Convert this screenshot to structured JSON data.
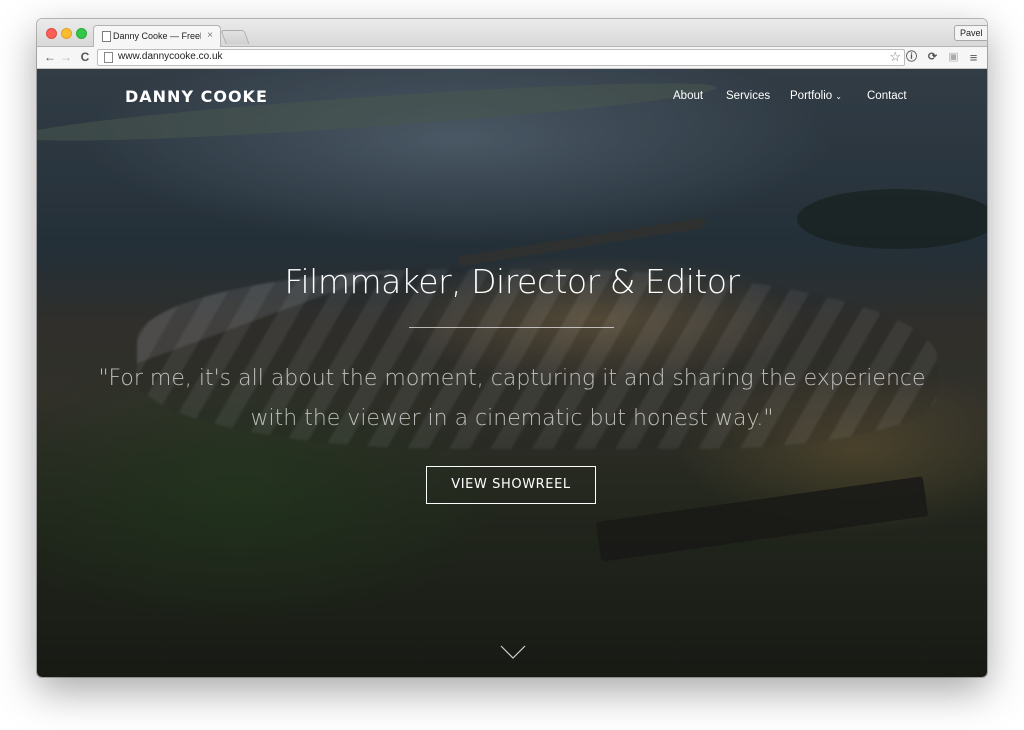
{
  "browser": {
    "tab_title": "Danny Cooke — Freelance",
    "tab_close_glyph": "×",
    "profile_name": "Pavel",
    "url": "www.dannycooke.co.uk",
    "icons": [
      "back-arrow-icon",
      "forward-arrow-icon",
      "reload-icon",
      "page-icon",
      "star-icon",
      "info-extension-icon",
      "sync-extension-icon",
      "camera-extension-icon",
      "menu-icon"
    ]
  },
  "site": {
    "brand": "DANNY COOKE",
    "nav": {
      "about": "About",
      "services": "Services",
      "portfolio": "Portfolio",
      "contact": "Contact"
    },
    "hero": {
      "headline": "Filmmaker, Director & Editor",
      "quote": "\"For me, it's all about the moment, capturing it and sharing the experience with the viewer in a cinematic but honest way.\"",
      "cta_label": "VIEW SHOWREEL"
    }
  },
  "colors": {
    "traffic_close": "#fc5f57",
    "traffic_minimize": "#fdbc2e",
    "traffic_maximize": "#33c748",
    "hero_text": "#ffffff"
  }
}
